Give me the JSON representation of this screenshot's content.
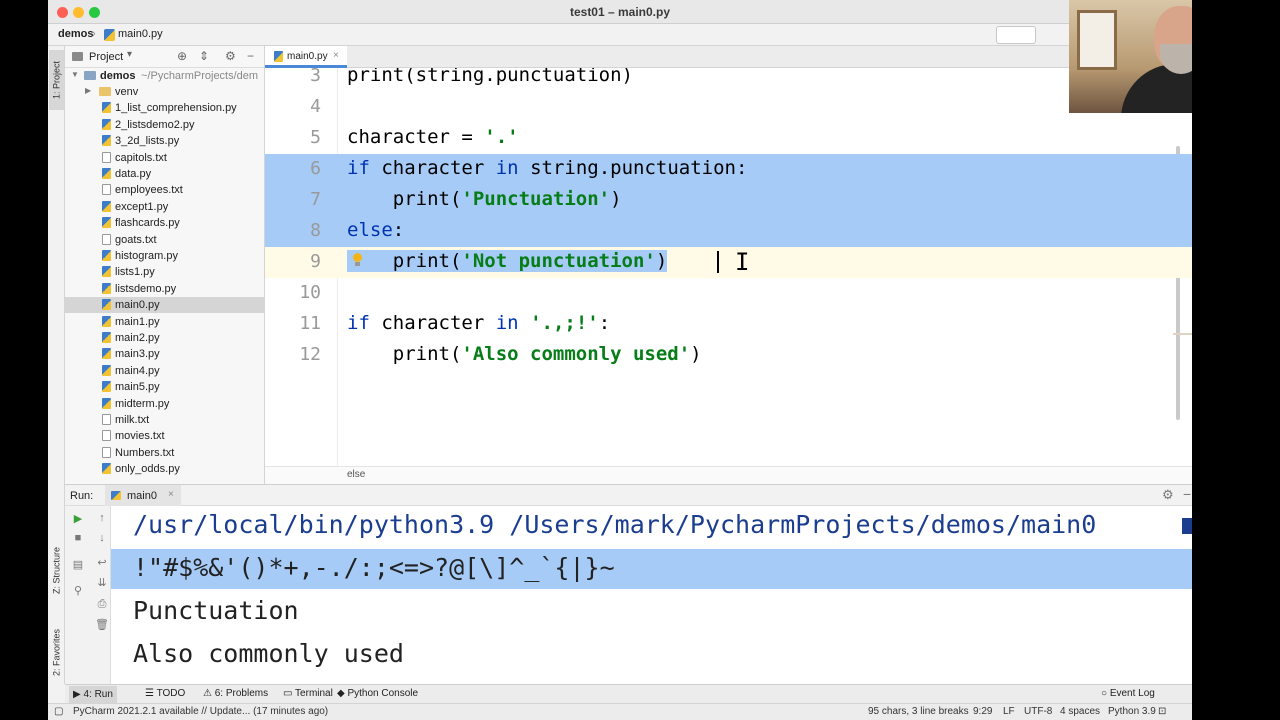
{
  "window": {
    "title": "test01 – main0.py"
  },
  "navbar": {
    "root": "demos",
    "separator": "›",
    "file": "main0.py"
  },
  "toolstrip": {
    "project_tab": "1: Project",
    "structure_tab": "Z: Structure",
    "favorites_tab": "2: Favorites"
  },
  "project_panel": {
    "title": "Project",
    "root_name": "demos",
    "root_path": "~/PycharmProjects/dem",
    "items": [
      {
        "label": "venv",
        "type": "folder"
      },
      {
        "label": "1_list_comprehension.py",
        "type": "py"
      },
      {
        "label": "2_listsdemo2.py",
        "type": "py"
      },
      {
        "label": "3_2d_lists.py",
        "type": "py"
      },
      {
        "label": "capitols.txt",
        "type": "txt"
      },
      {
        "label": "data.py",
        "type": "py"
      },
      {
        "label": "employees.txt",
        "type": "txt"
      },
      {
        "label": "except1.py",
        "type": "py"
      },
      {
        "label": "flashcards.py",
        "type": "py"
      },
      {
        "label": "goats.txt",
        "type": "txt"
      },
      {
        "label": "histogram.py",
        "type": "py"
      },
      {
        "label": "lists1.py",
        "type": "py"
      },
      {
        "label": "listsdemo.py",
        "type": "py"
      },
      {
        "label": "main0.py",
        "type": "py",
        "selected": true
      },
      {
        "label": "main1.py",
        "type": "py"
      },
      {
        "label": "main2.py",
        "type": "py"
      },
      {
        "label": "main3.py",
        "type": "py"
      },
      {
        "label": "main4.py",
        "type": "py"
      },
      {
        "label": "main5.py",
        "type": "py"
      },
      {
        "label": "midterm.py",
        "type": "py"
      },
      {
        "label": "milk.txt",
        "type": "txt"
      },
      {
        "label": "movies.txt",
        "type": "txt"
      },
      {
        "label": "Numbers.txt",
        "type": "txt"
      },
      {
        "label": "only_odds.py",
        "type": "py"
      }
    ]
  },
  "editor": {
    "tab_label": "main0.py",
    "tab_close": "×",
    "lines": [
      {
        "n": "3",
        "parts": [
          [
            "",
            "print(string.punctuation)"
          ]
        ]
      },
      {
        "n": "4",
        "parts": [
          [
            "",
            ""
          ]
        ]
      },
      {
        "n": "5",
        "parts": [
          [
            "",
            "character = "
          ],
          [
            "str",
            "'.'"
          ]
        ]
      },
      {
        "n": "6",
        "parts": [
          [
            "kw",
            "if"
          ],
          [
            "",
            " character "
          ],
          [
            "kw",
            "in"
          ],
          [
            "",
            " string.punctuation:"
          ]
        ]
      },
      {
        "n": "7",
        "parts": [
          [
            "",
            "    print("
          ],
          [
            "str",
            "'Punctuation'"
          ],
          [
            "",
            ")"
          ]
        ]
      },
      {
        "n": "8",
        "parts": [
          [
            "kw",
            "else"
          ],
          [
            "",
            ":"
          ]
        ]
      },
      {
        "n": "9",
        "parts": [
          [
            "",
            "    print("
          ],
          [
            "str",
            "'Not punctuation'"
          ],
          [
            "",
            ")"
          ]
        ]
      },
      {
        "n": "10",
        "parts": [
          [
            "",
            ""
          ]
        ]
      },
      {
        "n": "11",
        "parts": [
          [
            "kw",
            "if"
          ],
          [
            "",
            " character "
          ],
          [
            "kw",
            "in"
          ],
          [
            "",
            " "
          ],
          [
            "str",
            "'.,;!'"
          ],
          [
            "",
            ":"
          ]
        ]
      },
      {
        "n": "12",
        "parts": [
          [
            "",
            "    print("
          ],
          [
            "str",
            "'Also commonly used'"
          ],
          [
            "",
            ")"
          ]
        ]
      }
    ],
    "breadcrumb": "else"
  },
  "run_panel": {
    "label": "Run:",
    "tab": "main0",
    "tab_close": "×",
    "output": [
      "/usr/local/bin/python3.9 /Users/mark/PycharmProjects/demos/main0",
      "!\"#$%&'()*+,-./:;<=>?@[\\]^_`{|}~",
      "Punctuation",
      "Also commonly used"
    ]
  },
  "bottom_tabs": {
    "run": "4: Run",
    "todo": "TODO",
    "problems": "6: Problems",
    "terminal": "Terminal",
    "python_console": "Python Console",
    "event_log": "Event Log"
  },
  "status": {
    "message": "PyCharm 2021.2.1 available // Update... (17 minutes ago)",
    "chars": "95 chars, 3 line breaks",
    "position": "9:29",
    "line_sep": "LF",
    "encoding": "UTF-8",
    "indent": "4 spaces",
    "interpreter": "Python 3.9"
  },
  "colors": {
    "selection": "#a6cbf7",
    "keyword": "#0033b3",
    "string": "#067d17"
  }
}
